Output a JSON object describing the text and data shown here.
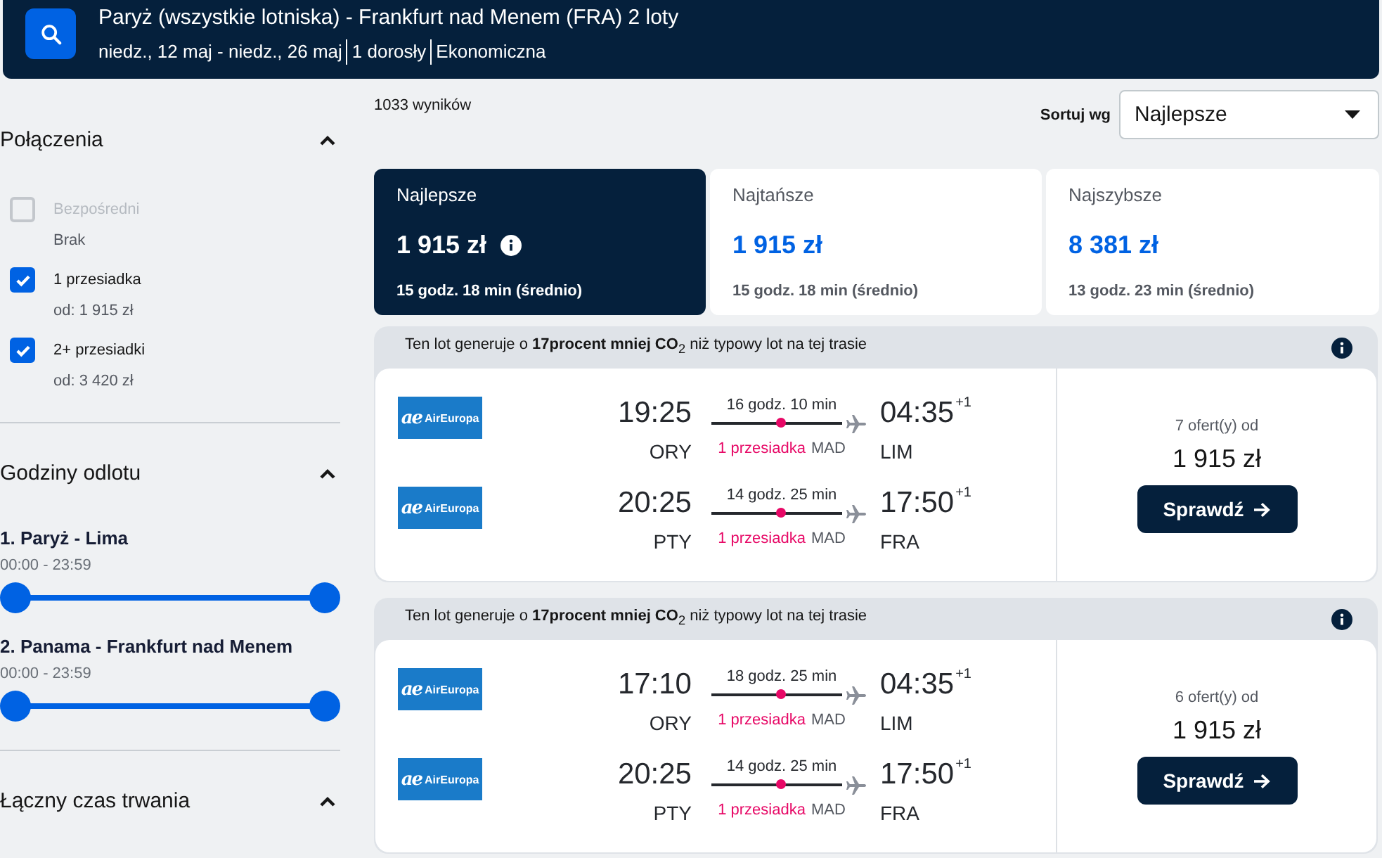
{
  "search_summary": {
    "title": "Paryż (wszystkie lotniska) - Frankfurt nad Menem (FRA) 2 loty",
    "details": [
      "niedz., 12 maj - niedz., 26 maj",
      "1 dorosły",
      "Ekonomiczna"
    ]
  },
  "filters": [
    {
      "kind": "stops",
      "title": "Połączenia",
      "expanded": true,
      "options": [
        {
          "label": "Bezpośredni",
          "note": "Brak",
          "checked": false,
          "disabled": true
        },
        {
          "label": "1 przesiadka",
          "note": "od: 1 915 zł",
          "checked": true,
          "disabled": false
        },
        {
          "label": "2+ przesiadki",
          "note": "od: 3 420 zł",
          "checked": true,
          "disabled": false
        }
      ]
    },
    {
      "kind": "times",
      "title": "Godziny odlotu",
      "expanded": true,
      "sliders": [
        {
          "label": "1. Paryż - Lima",
          "range": "00:00 - 23:59",
          "thumbs": [
            {
              "level": 0
            },
            {
              "level": 1
            }
          ]
        },
        {
          "label": "2. Panama - Frankfurt nad Menem",
          "range": "00:00 - 23:59",
          "thumbs": [
            {
              "level": 0
            },
            {
              "level": 1
            }
          ]
        }
      ]
    },
    {
      "kind": "duration",
      "title": "Łączny czas trwania",
      "expanded": true
    }
  ],
  "results": {
    "count": "1033 wyników",
    "sort": {
      "label": "Sortuj wg",
      "value": "Najlepsze"
    }
  },
  "sort_tabs": [
    {
      "label": "Najlepsze",
      "price": "1 915 zł",
      "duration": "15 godz. 18 min (średnio)",
      "selected": true
    },
    {
      "label": "Najtańsze",
      "price": "1 915 zł",
      "duration": "15 godz. 18 min (średnio)",
      "selected": false
    },
    {
      "label": "Najszybsze",
      "price": "8 381 zł",
      "duration": "13 godz. 23 min (średnio)",
      "selected": false
    }
  ],
  "flights": [
    {
      "emissions_note": "Ten lot generuje o **17procent mniej CO**$_{2}$ niż typowy lot na tej trasie",
      "legs": [
        {
          "airline_mark": "ae",
          "airline_name": "AirEuropa",
          "depart_time": "19:25",
          "depart_airport": "ORY",
          "duration": "16 godz. 10 min",
          "stops": "1 przesiadka",
          "via": "MAD",
          "arrive_time": "04:35",
          "day_offset": "+1",
          "arrive_airport": "LIM"
        },
        {
          "airline_mark": "ae",
          "airline_name": "AirEuropa",
          "depart_time": "20:25",
          "depart_airport": "PTY",
          "duration": "14 godz. 25 min",
          "stops": "1 przesiadka",
          "via": "MAD",
          "arrive_time": "17:50",
          "day_offset": "+1",
          "arrive_airport": "FRA"
        }
      ],
      "offers": "7 ofert(y) od",
      "price": "1 915 zł",
      "button": "Sprawdź"
    },
    {
      "emissions_note": "Ten lot generuje o **17procent mniej CO**$_{2}$ niż typowy lot na tej trasie",
      "legs": [
        {
          "airline_mark": "ae",
          "airline_name": "AirEuropa",
          "depart_time": "17:10",
          "depart_airport": "ORY",
          "duration": "18 godz. 25 min",
          "stops": "1 przesiadka",
          "via": "MAD",
          "arrive_time": "04:35",
          "day_offset": "+1",
          "arrive_airport": "LIM"
        },
        {
          "airline_mark": "ae",
          "airline_name": "AirEuropa",
          "depart_time": "20:25",
          "depart_airport": "PTY",
          "duration": "14 godz. 25 min",
          "stops": "1 przesiadka",
          "via": "MAD",
          "arrive_time": "17:50",
          "day_offset": "+1",
          "arrive_airport": "FRA"
        }
      ],
      "offers": "6 ofert(y) od",
      "price": "1 915 zł",
      "button": "Sprawdź"
    }
  ]
}
